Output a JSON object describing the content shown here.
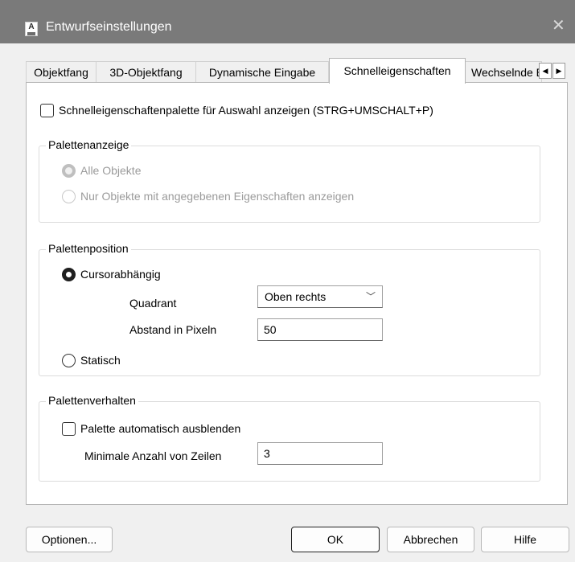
{
  "window": {
    "title": "Entwurfseinstellungen",
    "app_icon_letter": "A",
    "close_symbol": "✕"
  },
  "tabs": [
    {
      "label": "Objektfang"
    },
    {
      "label": "3D-Objektfang"
    },
    {
      "label": "Dynamische Eingabe"
    },
    {
      "label": "Schnelleigenschaften",
      "active": true
    },
    {
      "label": "Wechselnde Bemaßungen"
    }
  ],
  "tab_scroll": {
    "left": "◀",
    "right": "▶"
  },
  "show_palette": {
    "label": "Schnelleigenschaftenpalette für Auswahl anzeigen (STRG+UMSCHALT+P)",
    "checked": false
  },
  "palette_display": {
    "legend": "Palettenanzeige",
    "options": [
      {
        "label": "Alle Objekte",
        "selected": true,
        "enabled": false
      },
      {
        "label": "Nur Objekte mit angegebenen Eigenschaften anzeigen",
        "selected": false,
        "enabled": false
      }
    ]
  },
  "palette_position": {
    "legend": "Palettenposition",
    "cursor_label": "Cursorabhängig",
    "cursor_selected": true,
    "quadrant_label": "Quadrant",
    "quadrant_value": "Oben rechts",
    "distance_label": "Abstand in Pixeln",
    "distance_value": "50",
    "static_label": "Statisch",
    "static_selected": false
  },
  "palette_behavior": {
    "legend": "Palettenverhalten",
    "auto_hide_label": "Palette automatisch ausblenden",
    "auto_hide_checked": false,
    "min_rows_label": "Minimale Anzahl von Zeilen",
    "min_rows_value": "3"
  },
  "buttons": {
    "options": "Optionen...",
    "ok": "OK",
    "cancel": "Abbrechen",
    "help": "Hilfe"
  }
}
